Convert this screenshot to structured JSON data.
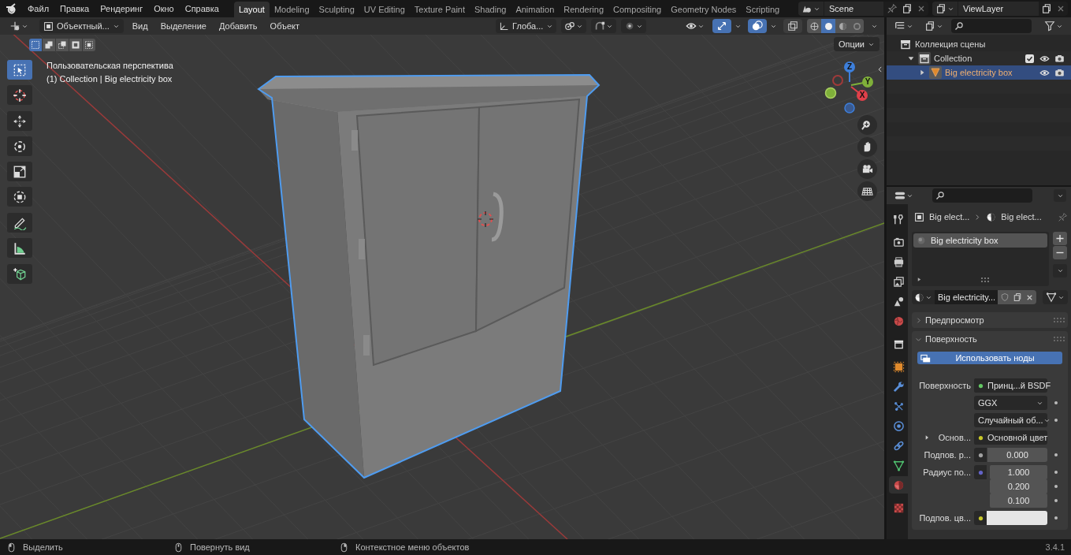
{
  "top_menu": [
    "Файл",
    "Правка",
    "Рендеринг",
    "Окно",
    "Справка"
  ],
  "workspaces": [
    {
      "label": "Layout",
      "selected": true
    },
    {
      "label": "Modeling",
      "selected": false
    },
    {
      "label": "Sculpting",
      "selected": false
    },
    {
      "label": "UV Editing",
      "selected": false
    },
    {
      "label": "Texture Paint",
      "selected": false
    },
    {
      "label": "Shading",
      "selected": false
    },
    {
      "label": "Animation",
      "selected": false
    },
    {
      "label": "Rendering",
      "selected": false
    },
    {
      "label": "Compositing",
      "selected": false
    },
    {
      "label": "Geometry Nodes",
      "selected": false
    },
    {
      "label": "Scripting",
      "selected": false
    }
  ],
  "scene": "Scene",
  "view_layer": "ViewLayer",
  "viewport_header": {
    "mode": "Объектный...",
    "menus": [
      "Вид",
      "Выделение",
      "Добавить",
      "Объект"
    ],
    "orientation": "Глоба...",
    "toggles": [
      {
        "kind": "gizmo",
        "on": true
      },
      {
        "kind": "overlay",
        "on": true
      },
      {
        "kind": "xray",
        "on": false
      }
    ],
    "shading": [
      {
        "kind": "wireframe",
        "selected": false
      },
      {
        "kind": "solid",
        "selected": true
      },
      {
        "kind": "material",
        "selected": false
      },
      {
        "kind": "rendered",
        "selected": false
      }
    ]
  },
  "select_modes": [
    {
      "kind": "new",
      "selected": true
    },
    {
      "kind": "extend",
      "selected": false
    },
    {
      "kind": "subtract",
      "selected": false
    },
    {
      "kind": "invert",
      "selected": false
    },
    {
      "kind": "intersect",
      "selected": false
    }
  ],
  "viewport": {
    "options": "Опции",
    "view_name": "Пользовательская перспектива",
    "object_info": "(1) Collection | Big electricity box",
    "axes": [
      "Z",
      "Y",
      "X"
    ]
  },
  "tool_groups": [
    [
      {
        "kind": "select",
        "selected": true
      },
      {
        "kind": "cursor",
        "selected": false
      }
    ],
    [
      {
        "kind": "move",
        "selected": false
      },
      {
        "kind": "rotate",
        "selected": false
      },
      {
        "kind": "scale",
        "selected": false
      },
      {
        "kind": "transform",
        "selected": false
      }
    ],
    [
      {
        "kind": "annotate",
        "selected": false
      },
      {
        "kind": "measure",
        "selected": false
      }
    ],
    [
      {
        "kind": "add_cube",
        "selected": false
      }
    ]
  ],
  "outliner": {
    "items": [
      {
        "kind": "scene_collection",
        "label": "Коллекция сцены",
        "selected": false,
        "children": [
          {
            "kind": "collection",
            "label": "Collection",
            "selected": false,
            "expanded": true,
            "checked": true,
            "children": [
              {
                "kind": "object",
                "label": "Big electricity box",
                "selected": true,
                "expanded": false
              }
            ]
          }
        ]
      }
    ]
  },
  "properties": {
    "tab_groups": [
      [
        {
          "kind": "tool",
          "selected": false
        }
      ],
      [
        {
          "kind": "render",
          "selected": false
        },
        {
          "kind": "output",
          "selected": false
        },
        {
          "kind": "view_layer",
          "selected": false
        },
        {
          "kind": "scene",
          "selected": false
        },
        {
          "kind": "world",
          "selected": false
        }
      ],
      [
        {
          "kind": "collection",
          "selected": false
        }
      ],
      [
        {
          "kind": "object",
          "selected": false
        },
        {
          "kind": "modifiers",
          "selected": false
        },
        {
          "kind": "particles",
          "selected": false
        },
        {
          "kind": "physics",
          "selected": false
        },
        {
          "kind": "constraints",
          "selected": false
        },
        {
          "kind": "data",
          "selected": false
        },
        {
          "kind": "material",
          "selected": true
        }
      ],
      [
        {
          "kind": "texture",
          "selected": false
        }
      ]
    ],
    "breadcrumb": [
      "Big elect...",
      "Big elect..."
    ],
    "slots": [
      {
        "label": "Big electricity box",
        "selected": true
      }
    ],
    "material": "Big electricity...",
    "panels": [
      {
        "label": "Предпросмотр",
        "expanded": false
      },
      {
        "label": "Поверхность",
        "expanded": true
      }
    ],
    "use_nodes": "Использовать ноды",
    "fields": [
      {
        "kind": "socket",
        "label": "Поверхность",
        "value": "Принц...й BSDF",
        "color": "#63c763"
      },
      {
        "kind": "dropdown",
        "value": "GGX"
      },
      {
        "kind": "dropdown",
        "value": "Случайный об..."
      },
      {
        "kind": "socket",
        "label": "Основ...",
        "value": "Основной цвет",
        "color": "#c7c729",
        "expanded": false
      },
      {
        "kind": "number",
        "label": "Подпов. р...",
        "value": "0.000",
        "color": "#a1a1a1"
      },
      {
        "kind": "vector",
        "label": "Радиус по...",
        "values": [
          "1.000",
          "0.200",
          "0.100"
        ],
        "color": "#6363c7"
      },
      {
        "kind": "color",
        "label": "Подпов. цв...",
        "color": "#c7c729",
        "swatch": {
          "color": "#e6e6e6"
        }
      }
    ]
  },
  "status_bar": {
    "hints": [
      {
        "kind": "left",
        "label": "Выделить"
      },
      {
        "kind": "middle",
        "label": "Повернуть вид"
      },
      {
        "kind": "right",
        "label": "Контекстное меню объектов"
      }
    ],
    "version": "3.4.1"
  }
}
